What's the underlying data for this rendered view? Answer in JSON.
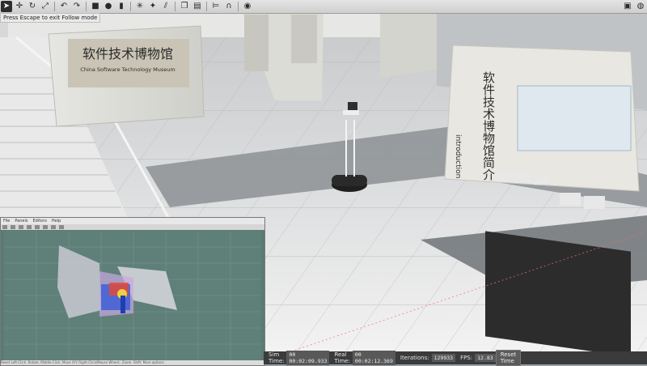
{
  "app": {
    "name": "Gazebo"
  },
  "toolbar": {
    "left_tools": [
      "select-arrow-icon",
      "move-icon",
      "rotate-icon",
      "scale-icon",
      "undo-icon",
      "redo-icon",
      "box-icon",
      "sphere-icon",
      "cylinder-icon",
      "point-light-icon",
      "spot-light-icon",
      "directional-light-icon",
      "copy-icon",
      "paste-icon",
      "align-icon",
      "snap-icon",
      "change-view-icon"
    ],
    "right_tools": [
      "screenshot-icon",
      "record-icon"
    ]
  },
  "hint": "Press Escape to exit Follow mode",
  "scene": {
    "museum_sign_cn": "软件技术博物馆",
    "museum_sign_en": "China Software Technology Museum",
    "intro_title_cn": "软件技术博物馆简介",
    "intro_title_en": "introduction"
  },
  "rviz": {
    "menu": [
      "File",
      "Panels",
      "Editors",
      "Help"
    ],
    "status_text": "Reset   Left-Click: Rotate.  Middle-Click: Move X/Y.  Right-Click/Mouse Wheel:: Zoom.  Shift: More options."
  },
  "status": {
    "sim_time_label": "Sim Time:",
    "sim_time": "00 00:02:09.933",
    "real_time_label": "Real Time:",
    "real_time": "00 00:02:12.369",
    "iterations_label": "Iterations:",
    "iterations": "129933",
    "fps_label": "FPS:",
    "fps": "12.83",
    "reset_label": "Reset Time"
  }
}
